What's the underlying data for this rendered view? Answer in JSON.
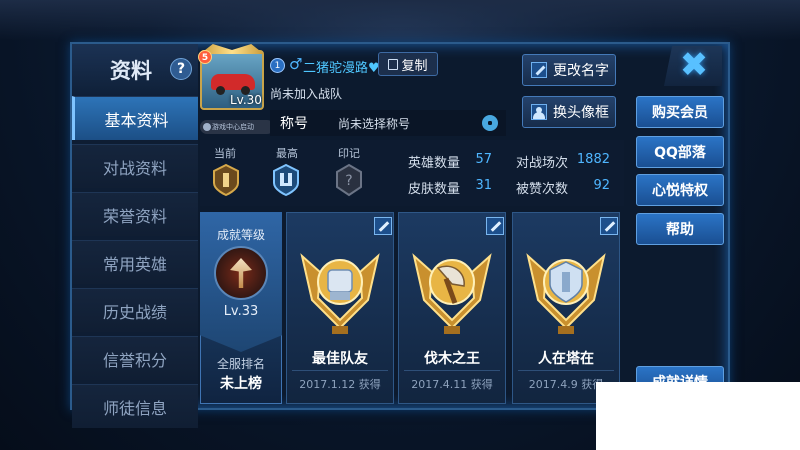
{
  "sidebar": {
    "title": "资料",
    "help_icon": "?",
    "items": [
      {
        "label": "基本资料",
        "active": true
      },
      {
        "label": "对战资料",
        "active": false
      },
      {
        "label": "荣誉资料",
        "active": false
      },
      {
        "label": "常用英雄",
        "active": false
      },
      {
        "label": "历史战绩",
        "active": false
      },
      {
        "label": "信誉积分",
        "active": false
      },
      {
        "label": "师徒信息",
        "active": false
      }
    ]
  },
  "profile": {
    "avatar_badge": "5",
    "level": "Lv.30",
    "game_center": "游戏中心启动",
    "vip_level": "1",
    "gender_icon": "♂",
    "nickname": "二猪驼漫路♥",
    "copy_label": "复制",
    "team_status": "尚未加入战队",
    "title_label": "称号",
    "title_value": "尚未选择称号"
  },
  "actions": {
    "rename": "更改名字",
    "change_frame": "换头像框"
  },
  "right_menu": [
    "购买会员",
    "QQ部落",
    "心悦特权",
    "帮助"
  ],
  "detail_button": "成就详情",
  "segments": [
    {
      "label": "当前",
      "icon": "bronze-rank-icon",
      "color": "#d6a94a"
    },
    {
      "label": "最高",
      "icon": "platinum-rank-icon",
      "color": "#7fc4ff"
    },
    {
      "label": "印记",
      "icon": "locked-mark-icon",
      "color": "#6b7486"
    }
  ],
  "stats": [
    {
      "label": "英雄数量",
      "value": "57"
    },
    {
      "label": "对战场次",
      "value": "1882"
    },
    {
      "label": "皮肤数量",
      "value": "31"
    },
    {
      "label": "被赞次数",
      "value": "92"
    }
  ],
  "achievement_rank": {
    "label": "成就等级",
    "level": "Lv.33",
    "server_rank_label": "全服排名",
    "server_rank_value": "未上榜"
  },
  "achievements": [
    {
      "title": "最佳队友",
      "date": "2017.1.12 获得",
      "icon": "fist-trophy-icon"
    },
    {
      "title": "伐木之王",
      "date": "2017.4.11 获得",
      "icon": "axe-trophy-icon"
    },
    {
      "title": "人在塔在",
      "date": "2017.4.9 获得",
      "icon": "tower-trophy-icon"
    }
  ],
  "colors": {
    "accent": "#2b74c6",
    "value_blue": "#4fb6ff",
    "gold": "#e0b24a"
  }
}
